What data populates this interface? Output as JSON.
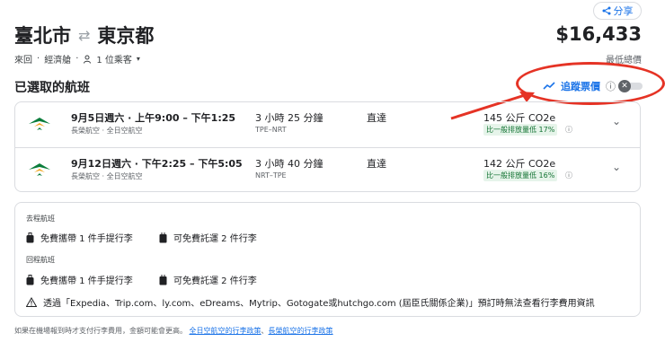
{
  "share": {
    "label": "分享"
  },
  "trip": {
    "origin": "臺北市",
    "destination": "東京都",
    "type": "來回",
    "cabin": "經濟艙",
    "passengers": "1 位乘客"
  },
  "price": {
    "amount": "$16,433",
    "caption": "最低總價"
  },
  "selected": {
    "title": "已選取的航班",
    "track_label": "追蹤票價"
  },
  "flights": [
    {
      "times": "9月5日週六 · 上午9:00 – 下午1:25",
      "airlines": "長榮航空 · 全日空航空",
      "duration": "3 小時 25 分鐘",
      "route": "TPE–NRT",
      "stops": "直達",
      "co2": "145 公斤 CO2e",
      "badge": "比一般排放量低 17%"
    },
    {
      "times": "9月12日週六 · 下午2:25 – 下午5:05",
      "airlines": "長榮航空 · 全日空航空",
      "duration": "3 小時 40 分鐘",
      "route": "NRT–TPE",
      "stops": "直達",
      "co2": "142 公斤 CO2e",
      "badge": "比一般排放量低 16%"
    }
  ],
  "baggage": {
    "outbound_label": "去程航班",
    "return_label": "回程航班",
    "outbound": {
      "carry_on": "免費攜帶 1 件手提行李",
      "checked": "可免費託運 2 件行李"
    },
    "return": {
      "carry_on": "免費攜帶 1 件手提行李",
      "checked": "可免費託運 2 件行李"
    },
    "warning": "透過「Expedia、Trip.com、ly.com、eDreams、Mytrip、Gotogate或hutchgo.com (屆臣氏關係企業)」預訂時無法查看行李費用資訊"
  },
  "footer": {
    "text": "如果在機場報到時才支付行李費用，金額可能會更高。",
    "link1": "全日空航空的行李政策",
    "separator": "、",
    "link2": "長榮航空的行李政策"
  },
  "colors": {
    "accent": "#1a73e8",
    "annotation": "#e53325",
    "green_badge": "#137333"
  }
}
